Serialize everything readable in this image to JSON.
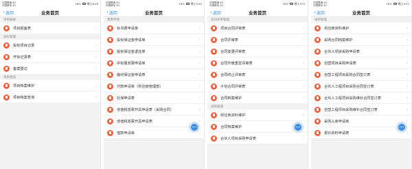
{
  "screens": [
    {
      "status": {
        "carrier_line1": "中国联通 4G",
        "carrier_line2": "中国移动 4G",
        "right": "18%",
        "time": "晚上8:48"
      },
      "nav": {
        "back": "返回",
        "title": "业务首页"
      },
      "sections": [
        {
          "title": "项目报备",
          "items": [
            "项目报备表"
          ]
        },
        {
          "title": "投标管理",
          "items": [
            "投标项目记录",
            "开标记录表",
            "备案登记"
          ]
        },
        {
          "title": "项目档案",
          "items": [
            "项目档案维护",
            "项目档案查询"
          ]
        }
      ]
    },
    {
      "status": {
        "carrier_line1": "中国联通 4G",
        "carrier_line2": "中国移动 4G",
        "right": "18%",
        "time": "晚上9:50"
      },
      "nav": {
        "back": "返回",
        "title": "业务首页"
      },
      "sections": [
        {
          "title": "费用申请",
          "items": [
            "标书费申请单",
            "投标保证金申请单",
            "投标保证金退还单",
            "中标服务费申请单",
            "履约保证金申请表",
            "付款申请单（供应链管理部）",
            "社保申请表",
            "增值税发票开具申请表（采购合同）",
            "增值税发票开具申请表",
            "借款申请单"
          ]
        }
      ]
    },
    {
      "status": {
        "carrier_line1": "中国联通 4G",
        "carrier_line2": "中国移动 4G",
        "right": "18%",
        "time": "晚上9:51"
      },
      "nav": {
        "back": "返回",
        "title": "业务首页"
      },
      "sections": [
        {
          "title": "合同评审管理",
          "items": [
            "项目合同评审表",
            "合同评审表",
            "合同变更评审表",
            "合同作废重签评审表",
            "合同终止评审表",
            "子包合同评审表",
            "合同档案维护"
          ]
        },
        {
          "title": "采购管理",
          "items": [
            "供应商资料维护",
            "合同档案维护",
            "合伙人项目采购申请表"
          ]
        }
      ]
    },
    {
      "status": {
        "carrier_line1": "中国联通 4G",
        "carrier_line2": "中国移动 4G",
        "right": "18%",
        "time": "晚上9:51"
      },
      "nav": {
        "back": "返回",
        "title": "业务首页"
      },
      "sections": [
        {
          "title": "采购管理",
          "items": [
            "供应商资料维护",
            "采购合同档案维护",
            "合伙人项目采购申请表",
            "自营项目采购申请表",
            "自营工程项目采购合同签订表",
            "合伙人工程项目采购合同签订表",
            "合伙人工程项目采购维补合同签订表",
            "自营工程项目采购维补合同签订表",
            "采购入库申请单",
            "报价资料申请表"
          ]
        }
      ]
    }
  ],
  "colors": {
    "accent": "#3a8ee6",
    "icon_bg": "#f0623f",
    "section_bg": "#f2f2f2"
  },
  "icons": {
    "back": "chevron-left-icon",
    "item": "document-icon",
    "arrow": "chevron-right-icon",
    "float": "assistant-float-icon"
  }
}
